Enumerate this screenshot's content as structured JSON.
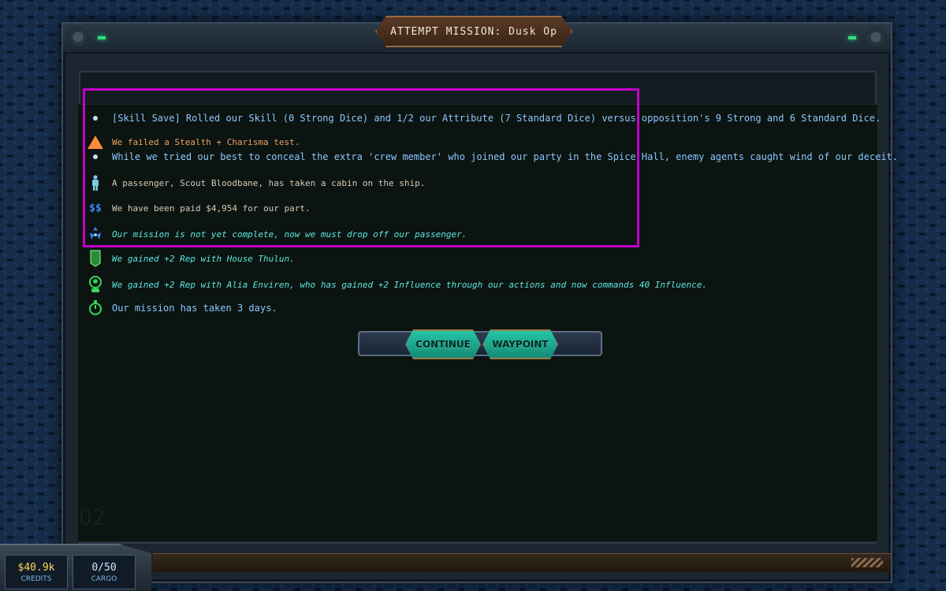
{
  "window": {
    "title": "ATTEMPT MISSION: Dusk Op"
  },
  "log": [
    {
      "icon": "bullet-icon",
      "text": "[Skill Save] Rolled our Skill (0 Strong Dice) and 1/2 our Attribute (7 Standard Dice) versus opposition's 9 Strong and 6 Standard Dice.",
      "color": "#8cc6ff"
    },
    {
      "icon": "warning-icon",
      "text": "We failed a Stealth + Charisma test.",
      "color": "#f2a165"
    },
    {
      "icon": "bullet-icon",
      "text": "While we tried our best to conceal the extra 'crew member' who joined our party in the Spice Hall, enemy agents caught wind of our deceit.",
      "color": "#8cc6ff"
    },
    {
      "icon": "passenger-icon",
      "text": "A passenger, Scout Bloodbane, has taken a cabin on the ship.",
      "color": "#d9c9b8"
    },
    {
      "icon": "credits-icon",
      "text": "We have been paid $4,954 for our part.",
      "color": "#d9c9b8"
    },
    {
      "icon": "mission-icon",
      "text": "Our mission is not yet complete, now we must drop off our passenger.",
      "color": "#5fe7e2"
    },
    {
      "icon": "house-rep-icon",
      "text": "We gained +2 Rep with House Thulun.",
      "color": "#5fe7e2"
    },
    {
      "icon": "contact-rep-icon",
      "text": "We gained +2 Rep with Alia Enviren, who has gained +2 Influence through our actions and now commands 40 Influence.",
      "color": "#5fe7e2"
    },
    {
      "icon": "timer-icon",
      "text": "Our mission has taken 3 days.",
      "color": "#8cc6ff"
    }
  ],
  "buttons": {
    "continue": "CONTINUE",
    "waypoint": "WAYPOINT"
  },
  "hud": {
    "credits_value": "$40.9k",
    "credits_label": "CREDITS",
    "cargo_value": "0/50",
    "cargo_label": "CARGO"
  },
  "panel_number": "02",
  "colors": {
    "accent_teal": "#27c4a6",
    "highlight_magenta": "#c400c8"
  }
}
